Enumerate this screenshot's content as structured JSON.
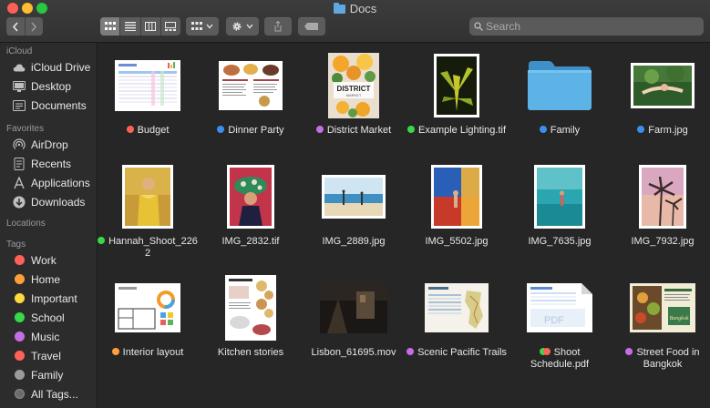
{
  "window": {
    "title": "Docs"
  },
  "search": {
    "placeholder": "Search"
  },
  "sidebar": {
    "icloud_heading": "iCloud",
    "icloud": [
      {
        "label": "iCloud Drive",
        "icon": "cloud-icon"
      },
      {
        "label": "Desktop",
        "icon": "desktop-icon"
      },
      {
        "label": "Documents",
        "icon": "documents-icon"
      }
    ],
    "favorites_heading": "Favorites",
    "favorites": [
      {
        "label": "AirDrop",
        "icon": "airdrop-icon"
      },
      {
        "label": "Recents",
        "icon": "recents-icon"
      },
      {
        "label": "Applications",
        "icon": "applications-icon"
      },
      {
        "label": "Downloads",
        "icon": "downloads-icon"
      }
    ],
    "locations_heading": "Locations",
    "tags_heading": "Tags",
    "tags": [
      {
        "label": "Work",
        "color": "#ff6257"
      },
      {
        "label": "Home",
        "color": "#ff9f3a"
      },
      {
        "label": "Important",
        "color": "#ffd93d"
      },
      {
        "label": "School",
        "color": "#38d84a"
      },
      {
        "label": "Music",
        "color": "#c66ee3"
      },
      {
        "label": "Travel",
        "color": "#ff6257"
      },
      {
        "label": "Family",
        "color": "#9a9a9a"
      },
      {
        "label": "All Tags...",
        "color": "#6c6c70"
      }
    ]
  },
  "files": [
    {
      "name": "Budget",
      "tag_color": "#ff6257",
      "kind": "spreadsheet"
    },
    {
      "name": "Dinner Party",
      "tag_color": "#3b8ef0",
      "kind": "menu"
    },
    {
      "name": "District Market",
      "tag_color": "#c66ee3",
      "kind": "poster"
    },
    {
      "name": "Example Lighting.tif",
      "tag_color": "#38d84a",
      "kind": "photo-plant"
    },
    {
      "name": "Family",
      "tag_color": "#3b8ef0",
      "kind": "folder"
    },
    {
      "name": "Farm.jpg",
      "tag_color": "#3b8ef0",
      "kind": "photo-farm"
    },
    {
      "name": "Hannah_Shoot_2262",
      "tag_color": "#38d84a",
      "kind": "photo-yellow"
    },
    {
      "name": "IMG_2832.tif",
      "tag_color": "",
      "kind": "photo-hat"
    },
    {
      "name": "IMG_2889.jpg",
      "tag_color": "",
      "kind": "photo-beach"
    },
    {
      "name": "IMG_5502.jpg",
      "tag_color": "",
      "kind": "photo-blue-red"
    },
    {
      "name": "IMG_7635.jpg",
      "tag_color": "",
      "kind": "photo-teal"
    },
    {
      "name": "IMG_7932.jpg",
      "tag_color": "",
      "kind": "photo-palm"
    },
    {
      "name": "Interior layout",
      "tag_color": "#ff9f3a",
      "kind": "floorplan"
    },
    {
      "name": "Kitchen stories",
      "tag_color": "",
      "kind": "kitchen-doc"
    },
    {
      "name": "Lisbon_61695.mov",
      "tag_color": "",
      "kind": "movie"
    },
    {
      "name": "Scenic Pacific Trails",
      "tag_color": "#c66ee3",
      "kind": "trail-doc"
    },
    {
      "name": "Shoot Schedule.pdf",
      "tag_color": "#38d84a",
      "tag_color2": "#ff6257",
      "kind": "pdf"
    },
    {
      "name": "Street Food in Bangkok",
      "tag_color": "#c66ee3",
      "kind": "food-doc"
    }
  ]
}
